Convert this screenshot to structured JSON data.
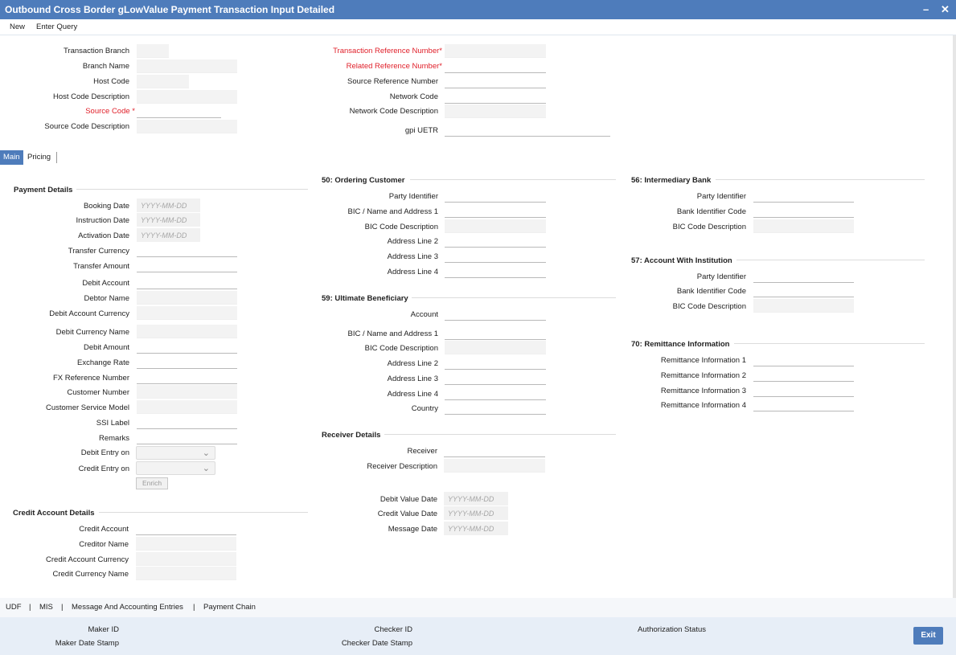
{
  "window": {
    "title": "Outbound Cross Border gLowValue Payment Transaction Input Detailed",
    "minimize": "–",
    "close": "✕"
  },
  "menu": {
    "new": "New",
    "enter_query": "Enter Query"
  },
  "header_left": {
    "transaction_branch": "Transaction Branch",
    "branch_name": "Branch Name",
    "host_code": "Host Code",
    "host_code_description": "Host Code Description",
    "source_code": "Source Code",
    "source_code_description": "Source Code Description"
  },
  "header_right": {
    "transaction_reference_number": "Transaction Reference Number",
    "related_reference_number": "Related Reference Number",
    "source_reference_number": "Source Reference Number",
    "network_code": "Network Code",
    "network_code_description": "Network Code Description",
    "gpi_uetr": "gpi UETR"
  },
  "required_mark": "*",
  "tabs": {
    "main": "Main",
    "pricing": "Pricing"
  },
  "date_placeholder": "YYYY-MM-DD",
  "payment_details": {
    "title": "Payment Details",
    "booking_date": "Booking Date",
    "instruction_date": "Instruction Date",
    "activation_date": "Activation Date",
    "transfer_currency": "Transfer Currency",
    "transfer_amount": "Transfer Amount",
    "debit_account": "Debit Account",
    "debtor_name": "Debtor Name",
    "debit_account_currency": "Debit Account Currency",
    "debit_currency_name": "Debit Currency Name",
    "debit_amount": "Debit Amount",
    "exchange_rate": "Exchange Rate",
    "fx_reference_number": "FX Reference Number",
    "customer_number": "Customer Number",
    "customer_service_model": "Customer Service Model",
    "ssi_label": "SSI Label",
    "remarks": "Remarks",
    "debit_entry_on": "Debit Entry on",
    "credit_entry_on": "Credit Entry on",
    "enrich": "Enrich"
  },
  "credit_account_details": {
    "title": "Credit Account Details",
    "credit_account": "Credit Account",
    "creditor_name": "Creditor Name",
    "credit_account_currency": "Credit Account Currency",
    "credit_currency_name": "Credit Currency Name"
  },
  "ordering_customer": {
    "title": "50: Ordering Customer",
    "party_identifier": "Party Identifier",
    "bic_name_address1": "BIC / Name and Address 1",
    "bic_code_description": "BIC Code Description",
    "address_line2": "Address Line 2",
    "address_line3": "Address Line 3",
    "address_line4": "Address Line 4"
  },
  "ultimate_beneficiary": {
    "title": "59: Ultimate Beneficiary",
    "account": "Account",
    "bic_name_address1": "BIC / Name and Address 1",
    "bic_code_description": "BIC Code Description",
    "address_line2": "Address Line 2",
    "address_line3": "Address Line 3",
    "address_line4": "Address Line 4",
    "country": "Country"
  },
  "receiver_details": {
    "title": "Receiver Details",
    "receiver": "Receiver",
    "receiver_description": "Receiver Description"
  },
  "value_dates": {
    "debit_value_date": "Debit Value Date",
    "credit_value_date": "Credit Value Date",
    "message_date": "Message Date"
  },
  "intermediary_bank": {
    "title": "56: Intermediary Bank",
    "party_identifier": "Party Identifier",
    "bank_identifier_code": "Bank Identifier Code",
    "bic_code_description": "BIC Code Description"
  },
  "account_with_institution": {
    "title": "57: Account With Institution",
    "party_identifier": "Party Identifier",
    "bank_identifier_code": "Bank Identifier Code",
    "bic_code_description": "BIC Code Description"
  },
  "remittance_information": {
    "title": "70: Remittance Information",
    "info1": "Remittance Information 1",
    "info2": "Remittance Information 2",
    "info3": "Remittance Information 3",
    "info4": "Remittance Information 4"
  },
  "bottom_links": {
    "udf": "UDF",
    "mis": "MIS",
    "message_entries": "Message And Accounting Entries",
    "payment_chain": "Payment Chain",
    "sep": "|"
  },
  "footer": {
    "maker_id": "Maker ID",
    "maker_date_stamp": "Maker Date Stamp",
    "checker_id": "Checker ID",
    "checker_date_stamp": "Checker Date Stamp",
    "authorization_status": "Authorization Status",
    "exit": "Exit"
  },
  "colors": {
    "accent": "#4e7cbb",
    "required": "#e0202a",
    "footer_bg": "#e7eef7"
  }
}
